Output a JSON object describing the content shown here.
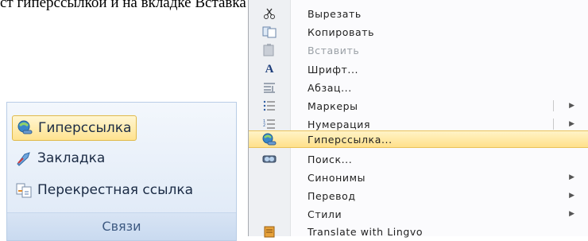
{
  "page_text": "ст гиперссылкой и на вкладке Вставка в группе Связи в",
  "ribbon": {
    "group_label": "Связи",
    "buttons": [
      {
        "label": "Гиперссылка",
        "icon": "hyperlink-icon"
      },
      {
        "label": "Закладка",
        "icon": "bookmark-icon"
      },
      {
        "label": "Перекрестная ссылка",
        "icon": "cross-reference-icon"
      }
    ]
  },
  "context_menu": {
    "items": [
      {
        "label": "Вырезать",
        "icon": "scissors-icon"
      },
      {
        "label": "Копировать",
        "icon": "copy-icon"
      },
      {
        "label": "Вставить",
        "icon": "paste-icon",
        "disabled": true
      },
      {
        "label": "Шрифт...",
        "icon": "font-icon"
      },
      {
        "label": "Абзац...",
        "icon": "paragraph-icon"
      },
      {
        "label": "Маркеры",
        "icon": "bullets-icon",
        "submenu": true
      },
      {
        "label": "Нумерация",
        "icon": "numbering-icon",
        "submenu": true
      },
      {
        "label": "Гиперссылка...",
        "icon": "hyperlink-icon",
        "highlighted": true
      },
      {
        "label": "Поиск...",
        "icon": "search-icon"
      },
      {
        "label": "Синонимы",
        "icon": "",
        "submenu": true
      },
      {
        "label": "Перевод",
        "icon": "",
        "submenu": true
      },
      {
        "label": "Стили",
        "icon": "",
        "submenu": true
      },
      {
        "label": "Translate with Lingvo",
        "icon": "lingvo-icon"
      }
    ]
  },
  "colors": {
    "highlight": "#ffe08a",
    "ribbon": "#dde8f6",
    "menu_gutter": "#eef0f3"
  }
}
